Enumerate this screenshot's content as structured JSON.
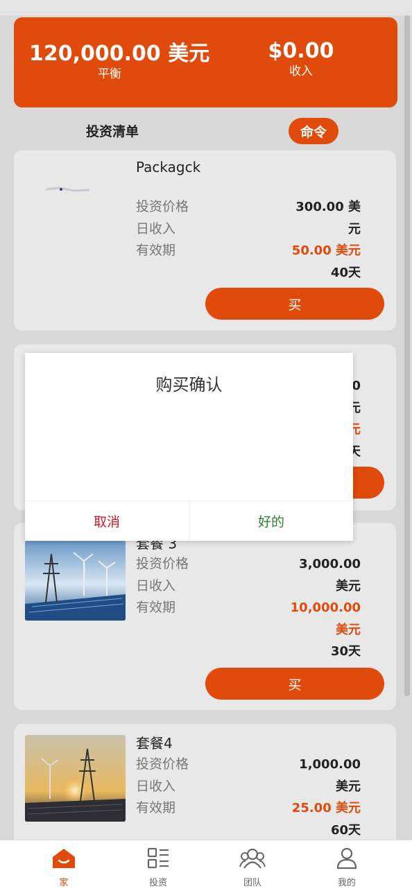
{
  "summary": {
    "balance": "120,000.00 美元",
    "balance_label": "平衡",
    "income": "$0.00",
    "income_label": "收入"
  },
  "list": {
    "title": "投资清单",
    "order_button": "命令"
  },
  "cards": [
    {
      "title": "Packagck",
      "labels": [
        "投资价格",
        "日收入",
        "有效期"
      ],
      "values": [
        "300.00 美",
        "元",
        "50.00 美元",
        "40天"
      ],
      "buy": "买"
    },
    {
      "values": [
        "0",
        "元",
        "元",
        "天"
      ]
    },
    {
      "title": "套餐 3",
      "labels": [
        "投资价格",
        "日收入",
        "有效期"
      ],
      "values": [
        "3,000.00",
        "美元",
        "10,000.00",
        "美元",
        "30天"
      ],
      "buy": "买"
    },
    {
      "title": "套餐4",
      "labels": [
        "投资价格",
        "日收入",
        "有效期"
      ],
      "values": [
        "1,000.00",
        "美元",
        "25.00 美元",
        "60天"
      ]
    }
  ],
  "modal": {
    "title": "购买确认",
    "cancel": "取消",
    "ok": "好的"
  },
  "tabs": [
    {
      "label": "家",
      "icon": "home-icon",
      "active": true
    },
    {
      "label": "投资",
      "icon": "invest-list-icon",
      "active": false
    },
    {
      "label": "团队",
      "icon": "team-icon",
      "active": false
    },
    {
      "label": "我的",
      "icon": "user-icon",
      "active": false
    }
  ],
  "colors": {
    "accent": "#e04a0a",
    "cancel": "#d4162a",
    "ok": "#2f7d2f"
  }
}
